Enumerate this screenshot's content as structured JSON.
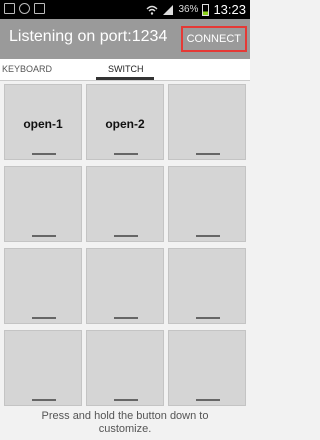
{
  "status_bar": {
    "battery": "36%",
    "time": "13:23",
    "battery_level": 0.36,
    "icons": [
      "notification-icon",
      "sync-icon",
      "image-icon",
      "wifi-icon",
      "signal-icon",
      "battery-icon"
    ]
  },
  "action_bar": {
    "title": "Listening on port:1234",
    "connect_label": "CONNECT"
  },
  "tabs": [
    {
      "label": "KEYBOARD",
      "selected": false
    },
    {
      "label": "SWITCH",
      "selected": true
    }
  ],
  "buttons": [
    {
      "label": "open-1"
    },
    {
      "label": "open-2"
    },
    {
      "label": ""
    },
    {
      "label": ""
    },
    {
      "label": ""
    },
    {
      "label": ""
    },
    {
      "label": ""
    },
    {
      "label": ""
    },
    {
      "label": ""
    },
    {
      "label": ""
    },
    {
      "label": ""
    },
    {
      "label": ""
    }
  ],
  "footer": {
    "hint_line1": "Press and hold the button down to",
    "hint_line2": "customize."
  }
}
